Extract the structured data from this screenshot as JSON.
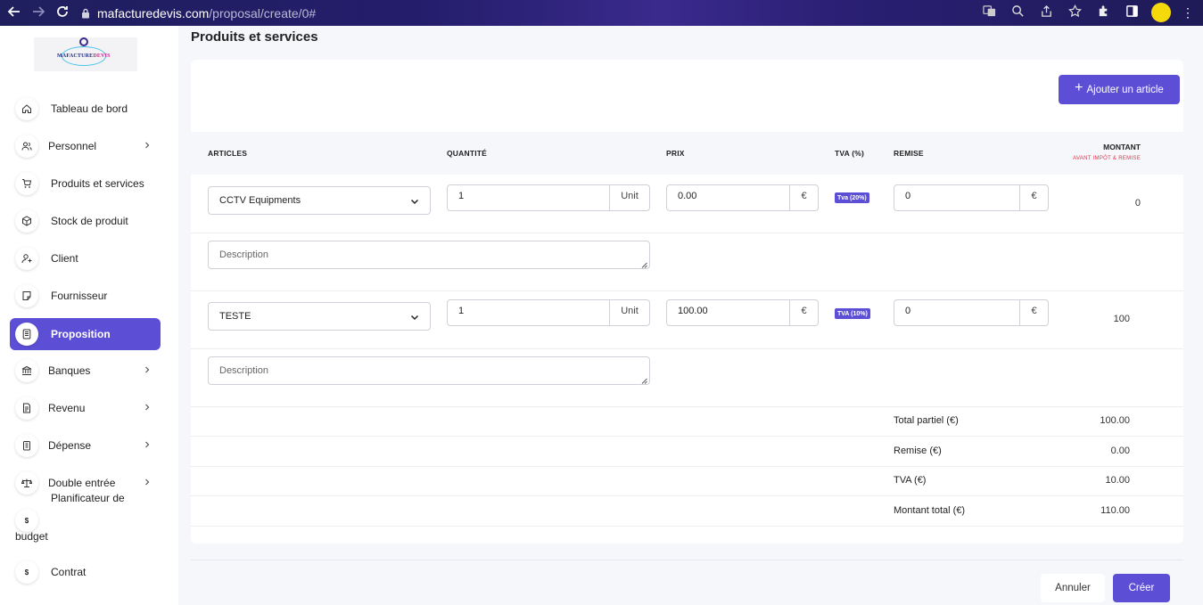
{
  "browser": {
    "url_host": "mafacturedevis.com",
    "url_path": "/proposal/create/0#"
  },
  "logo": {
    "text_a": "MAFACTURE",
    "text_b": "DEVIS"
  },
  "sidebar": {
    "items": [
      {
        "label": "Tableau de bord",
        "icon": "home-icon"
      },
      {
        "label": "Personnel",
        "icon": "users-icon",
        "has_children": true
      },
      {
        "label": "Produits et services",
        "icon": "cart-icon"
      },
      {
        "label": "Stock de produit",
        "icon": "box-icon"
      },
      {
        "label": "Client",
        "icon": "user-plus-icon"
      },
      {
        "label": "Fournisseur",
        "icon": "note-icon"
      },
      {
        "label": "Proposition",
        "icon": "document-icon",
        "active": true
      },
      {
        "label": "Banques",
        "icon": "bank-icon",
        "has_children": true
      },
      {
        "label": "Revenu",
        "icon": "file-icon",
        "has_children": true
      },
      {
        "label": "Dépense",
        "icon": "receipt-icon",
        "has_children": true
      },
      {
        "label": "Double entrée",
        "icon": "scale-icon",
        "has_children": true
      }
    ],
    "budget_label_line1": "Planificateur de",
    "budget_label_line2": "budget",
    "contract_label": "Contrat"
  },
  "page": {
    "title": "Produits et services"
  },
  "toolbar": {
    "add_article_label": "Ajouter un article"
  },
  "table": {
    "headers": {
      "articles": "ARTICLES",
      "quantity": "QUANTITÉ",
      "price": "PRIX",
      "vat": "TVA (%)",
      "discount": "REMISE",
      "amount": "MONTANT",
      "amount_sub": "AVANT IMPÔT & REMISE"
    },
    "rows": [
      {
        "article": "CCTV Equipments",
        "quantity": "1",
        "unit": "Unit",
        "price": "0.00",
        "currency": "€",
        "vat_badge": "Tva (20%)",
        "discount": "0",
        "discount_currency": "€",
        "amount": "0",
        "description_placeholder": "Description"
      },
      {
        "article": "TESTE",
        "quantity": "1",
        "unit": "Unit",
        "price": "100.00",
        "currency": "€",
        "vat_badge": "TVA (10%)",
        "discount": "0",
        "discount_currency": "€",
        "amount": "100",
        "description_placeholder": "Description"
      }
    ]
  },
  "totals": [
    {
      "label": "Total partiel (€)",
      "value": "100.00"
    },
    {
      "label": "Remise (€)",
      "value": "0.00"
    },
    {
      "label": "TVA (€)",
      "value": "10.00"
    },
    {
      "label": "Montant total (€)",
      "value": "110.00"
    }
  ],
  "footer": {
    "cancel_label": "Annuler",
    "create_label": "Créer"
  },
  "colors": {
    "accent": "#5c4fd6",
    "danger": "#e0334b"
  }
}
